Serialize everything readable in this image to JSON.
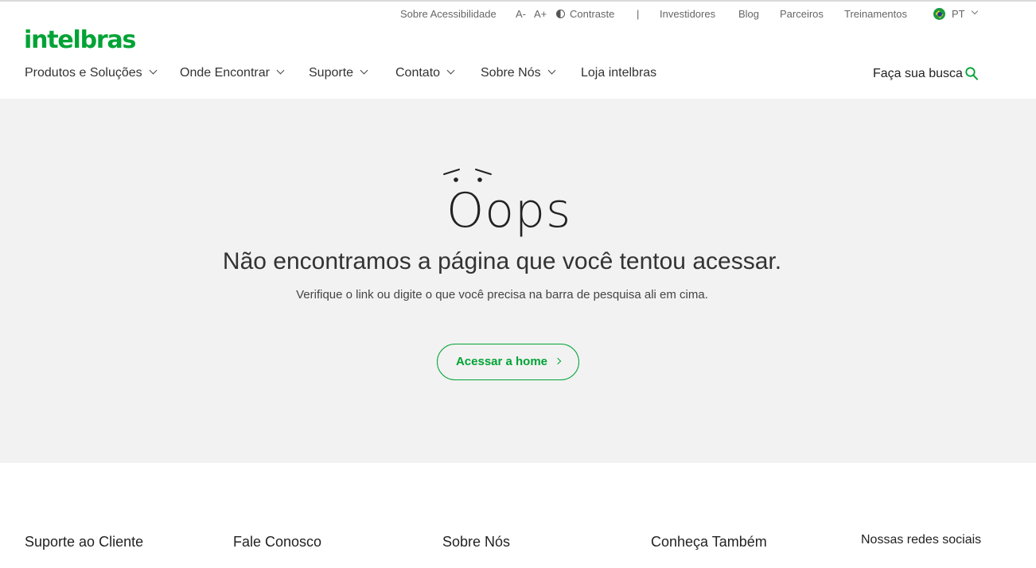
{
  "utility_bar": {
    "accessibility": "Sobre Acessibilidade",
    "font_decrease": "A-",
    "font_increase": "A+",
    "contrast": "Contraste",
    "separator": "|",
    "investors": "Investidores",
    "blog": "Blog",
    "partners": "Parceiros",
    "trainings": "Treinamentos",
    "language": "PT"
  },
  "brand": {
    "logo_text": "intelbras",
    "color": "#00a335"
  },
  "nav": {
    "items": [
      {
        "label": "Produtos e Soluções"
      },
      {
        "label": "Onde Encontrar"
      },
      {
        "label": "Suporte"
      },
      {
        "label": "Contato"
      },
      {
        "label": "Sobre Nós"
      },
      {
        "label": "Loja intelbras"
      }
    ],
    "search_label": "Faça sua busca"
  },
  "error": {
    "oops": "Oops",
    "title": "Não encontramos a página que você tentou acessar.",
    "subtitle": "Verifique o link ou digite o que você precisa na barra de pesquisa ali em cima.",
    "button_label": "Acessar a home"
  },
  "footer": {
    "columns": [
      {
        "heading": "Suporte ao Cliente"
      },
      {
        "heading": "Fale Conosco"
      },
      {
        "heading": "Sobre Nós"
      },
      {
        "heading": "Conheça Também"
      }
    ],
    "social_heading": "Nossas redes sociais"
  },
  "icons": [
    "contrast-icon",
    "brazil-flag-icon",
    "chevron-down-icon",
    "search-icon",
    "chevron-right-icon"
  ]
}
